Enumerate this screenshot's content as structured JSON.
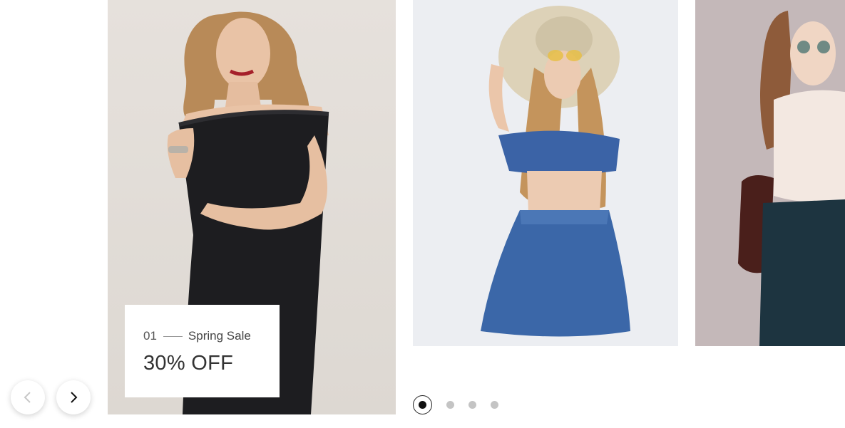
{
  "slides": [
    {
      "number": "01",
      "title": "Spring Sale",
      "offer": "30% OFF",
      "image": "woman-in-black-off-shoulder-dress"
    },
    {
      "image": "woman-in-denim-outfit-with-straw-hat"
    },
    {
      "image": "woman-in-white-top-and-dark-pants"
    }
  ],
  "navigation": {
    "prev_icon": "chevron-left-icon",
    "next_icon": "chevron-right-icon"
  },
  "pagination": {
    "total": 4,
    "active": 1
  },
  "colors": {
    "slide1_bg": "#e2ddd8",
    "slide2_bg": "#eceef2",
    "slide3_bg": "#c4b8b9",
    "dot_active": "#111111",
    "dot_inactive": "#c4c4c4"
  }
}
